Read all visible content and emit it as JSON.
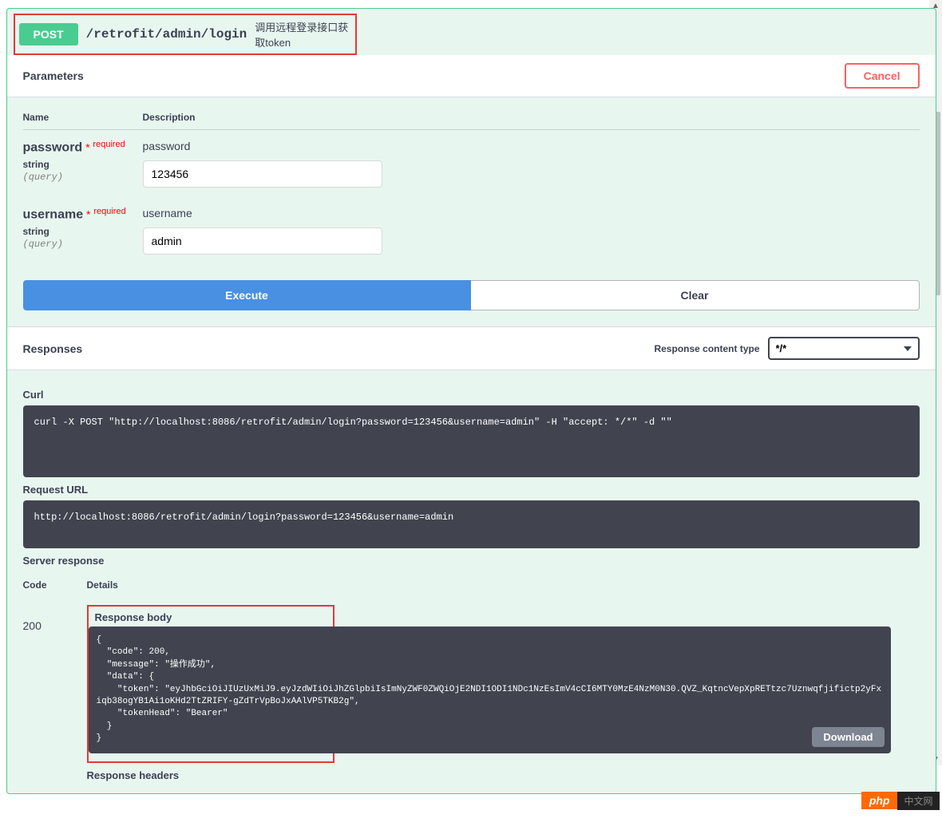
{
  "operation": {
    "method": "POST",
    "path": "/retrofit/admin/login",
    "summary": "调用远程登录接口获取token"
  },
  "parameters_section": {
    "title": "Parameters",
    "cancel": "Cancel",
    "head_name": "Name",
    "head_desc": "Description"
  },
  "params": [
    {
      "name": "password",
      "required": "required",
      "type": "string",
      "in": "(query)",
      "desc": "password",
      "value": "123456"
    },
    {
      "name": "username",
      "required": "required",
      "type": "string",
      "in": "(query)",
      "desc": "username",
      "value": "admin"
    }
  ],
  "buttons": {
    "execute": "Execute",
    "clear": "Clear",
    "download": "Download"
  },
  "responses_section": {
    "title": "Responses",
    "content_type_label": "Response content type",
    "content_type_value": "*/*"
  },
  "curl": {
    "label": "Curl",
    "command": "curl -X POST \"http://localhost:8086/retrofit/admin/login?password=123456&username=admin\" -H \"accept: */*\" -d \"\""
  },
  "request_url": {
    "label": "Request URL",
    "value": "http://localhost:8086/retrofit/admin/login?password=123456&username=admin"
  },
  "server_response": {
    "label": "Server response",
    "code_head": "Code",
    "details_head": "Details",
    "code": "200",
    "body_label": "Response body",
    "headers_label": "Response headers",
    "body": "{\n  \"code\": 200,\n  \"message\": \"操作成功\",\n  \"data\": {\n    \"token\": \"eyJhbGciOiJIUzUxMiJ9.eyJzdWIiOiJhZGlpbiIsImNyZWF0ZWQiOjE2NDI1ODI1NDc1NzEsImV4cCI6MTY0MzE4NzM0N30.QVZ_KqtncVepXpRETtzc7Uznwqfjifictp2yFxiqb38ogYB1Ai1oKHd2TtZRIFY-gZdTrVpBoJxAAlVP5TKB2g\",\n    \"tokenHead\": \"Bearer\"\n  }\n}"
  },
  "footer": {
    "php": "php",
    "cn": "中文网"
  }
}
